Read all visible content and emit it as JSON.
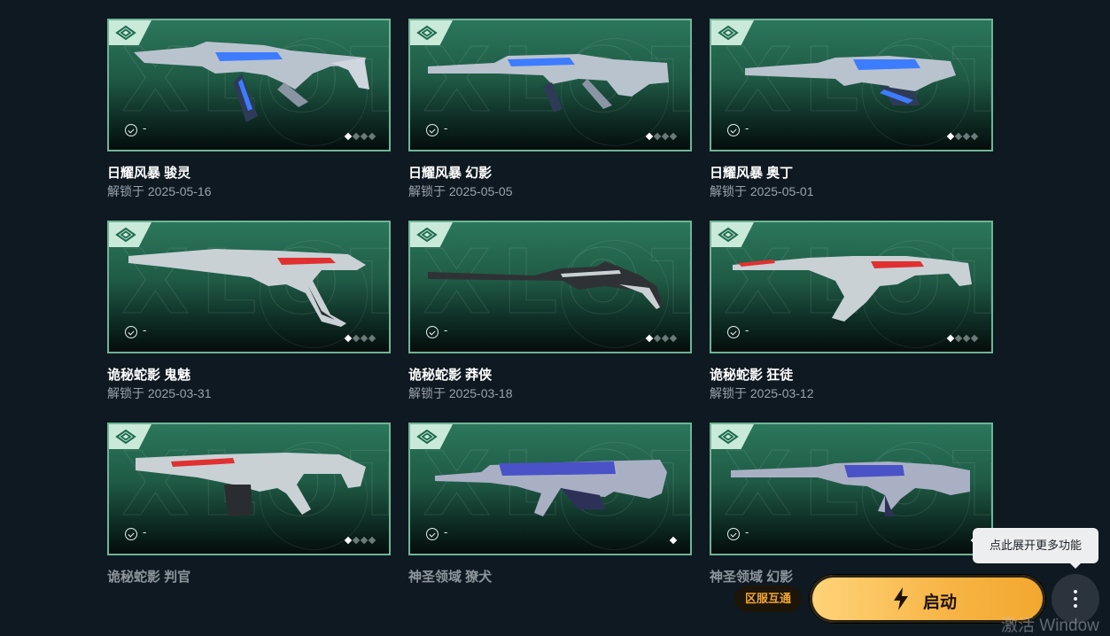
{
  "watermark": "XLOT",
  "items": [
    {
      "name": "日耀风暴 骏灵",
      "unlock": "解锁于 2025-05-16",
      "tier": "-",
      "level": 1,
      "max_level": 4,
      "weapon": "spectre",
      "accent": "#3d7cff"
    },
    {
      "name": "日耀风暴 幻影",
      "unlock": "解锁于 2025-05-05",
      "tier": "-",
      "level": 1,
      "max_level": 4,
      "weapon": "phantom",
      "accent": "#3d7cff"
    },
    {
      "name": "日耀风暴 奥丁",
      "unlock": "解锁于 2025-05-01",
      "tier": "-",
      "level": 1,
      "max_level": 4,
      "weapon": "odin",
      "accent": "#3d7cff"
    },
    {
      "name": "诡秘蛇影 鬼魅",
      "unlock": "解锁于 2025-03-31",
      "tier": "-",
      "level": 1,
      "max_level": 4,
      "weapon": "ghost",
      "accent": "#e03030"
    },
    {
      "name": "诡秘蛇影 莽侠",
      "unlock": "解锁于 2025-03-18",
      "tier": "-",
      "level": 1,
      "max_level": 4,
      "weapon": "outlaw",
      "accent": "#c9d1d5"
    },
    {
      "name": "诡秘蛇影 狂徒",
      "unlock": "解锁于 2025-03-12",
      "tier": "-",
      "level": 1,
      "max_level": 4,
      "weapon": "vandal",
      "accent": "#e03030"
    },
    {
      "name": "诡秘蛇影 判官",
      "unlock": "",
      "tier": "-",
      "level": 1,
      "max_level": 4,
      "weapon": "judge",
      "accent": "#e03030",
      "faded": true
    },
    {
      "name": "神圣领域 獠犬",
      "unlock": "",
      "tier": "-",
      "level": 1,
      "max_level": 1,
      "weapon": "bulldog",
      "accent": "#4a52c8",
      "faded": true
    },
    {
      "name": "神圣领域 幻影",
      "unlock": "",
      "tier": "-",
      "level": 1,
      "max_level": 1,
      "weapon": "phantom2",
      "accent": "#4a52c8",
      "faded": true
    }
  ],
  "footer": {
    "region_badge": "区服互通",
    "launch_label": "启动",
    "more_tooltip": "点此展开更多功能",
    "activate_text": "激活 Window"
  },
  "colors": {
    "card_border": "#6fb595",
    "launch_button": "#f7b444",
    "region_badge_text": "#f1a634"
  }
}
